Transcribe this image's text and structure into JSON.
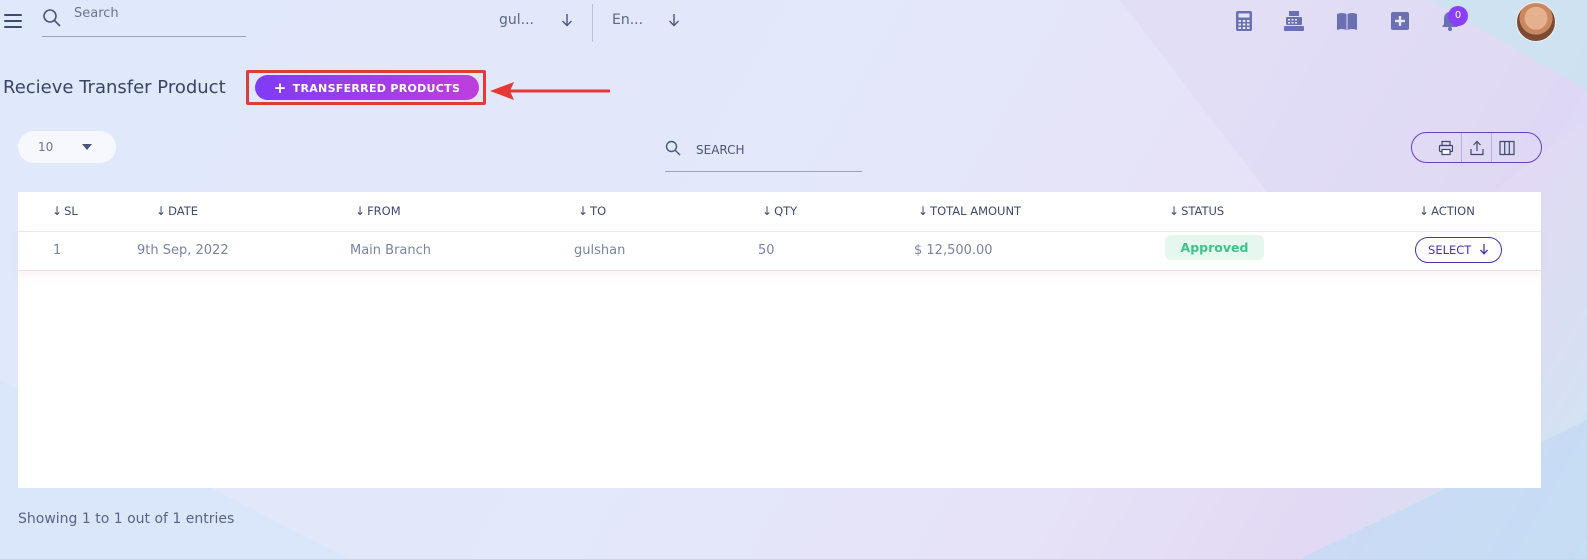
{
  "header": {
    "search_placeholder": "Search",
    "branch_select": "gul...",
    "language_select": "En...",
    "notification_count": "0",
    "icons": [
      "calculator-icon",
      "cash-register-icon",
      "book-icon",
      "plus-square-icon",
      "bell-icon"
    ]
  },
  "page": {
    "title": "Recieve Transfer Product",
    "transfer_button": "TRANSFERRED PRODUCTS"
  },
  "table_controls": {
    "per_page": "10",
    "search_placeholder": "SEARCH",
    "tools": [
      "print-icon",
      "export-icon",
      "columns-icon"
    ]
  },
  "table": {
    "columns": [
      "SL",
      "DATE",
      "FROM",
      "TO",
      "QTY",
      "TOTAL AMOUNT",
      "STATUS",
      "ACTION"
    ],
    "rows": [
      {
        "sl": "1",
        "date": "9th Sep, 2022",
        "from": "Main Branch",
        "to": "gulshan",
        "qty": "50",
        "total_amount": "$ 12,500.00",
        "status": "Approved",
        "action": "SELECT"
      }
    ]
  },
  "footer": {
    "entries_text": "Showing 1 to 1 out of 1 entries"
  },
  "colors": {
    "accent": "#7f3cf5",
    "annotation": "#e53935",
    "status_approved": "#3fc389"
  }
}
